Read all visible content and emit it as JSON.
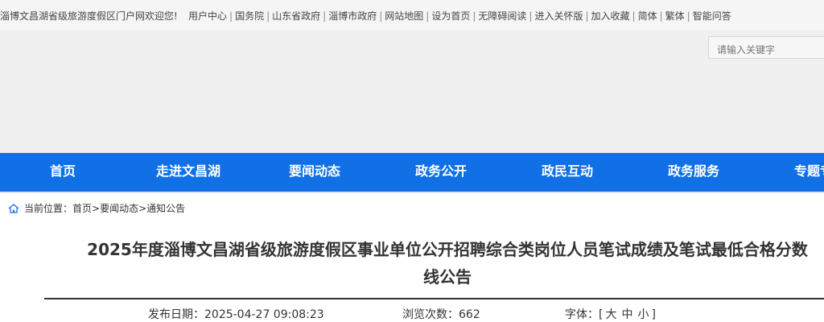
{
  "topbar": {
    "welcome": "淄博文昌湖省级旅游度假区门户网欢迎您!",
    "links": [
      "用户中心",
      "国务院",
      "山东省政府",
      "淄博市政府",
      "网站地图",
      "设为首页",
      "无障碍阅读",
      "进入关怀版",
      "加入收藏",
      "简体",
      "繁体",
      "智能问答"
    ]
  },
  "search": {
    "placeholder": "请输入关键字"
  },
  "nav": {
    "items": [
      "首页",
      "走进文昌湖",
      "要闻动态",
      "政务公开",
      "政民互动",
      "政务服务",
      "专题专"
    ]
  },
  "breadcrumb": {
    "prefix": "当前位置：",
    "items": [
      "首页",
      "要闻动态",
      "通知公告"
    ],
    "separator": ">"
  },
  "article": {
    "title_line1": "2025年度淄博文昌湖省级旅游度假区事业单位公开招聘综合类岗位人员笔试成绩及笔试最低合格分数",
    "title_line2": "线公告",
    "date_label": "发布日期：",
    "date_value": "2025-04-27 09:08:23",
    "views_label": "浏览次数：",
    "views_value": "662",
    "font_label": "字体：",
    "font_open": "[",
    "font_sizes": [
      "大",
      "中",
      "小"
    ],
    "font_close": "]"
  },
  "colors": {
    "nav_bg": "#1170e6",
    "banner_bg": "#f0f0f0",
    "topbar_bg": "#f5f5f5"
  }
}
